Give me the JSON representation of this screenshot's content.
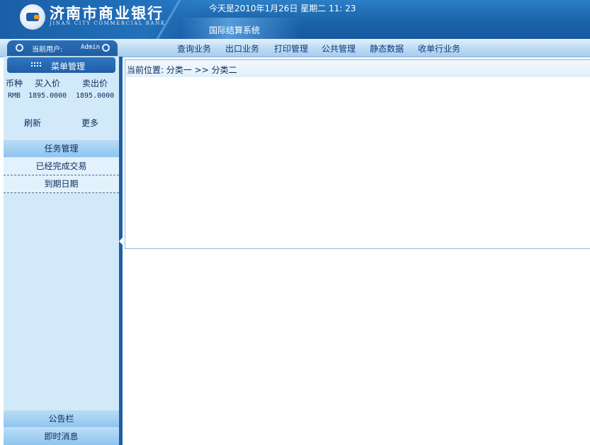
{
  "header": {
    "bank_name": "济南市商业银行",
    "bank_name_en": "JINAN CITY COMMERCIAL BANK",
    "date_text": "今天是2010年1月26日 星期二 11: 23",
    "system_name": "国际结算系统"
  },
  "user": {
    "current_label": "当前用户:",
    "username": "Admin"
  },
  "nav": {
    "items": [
      "查询业务",
      "出口业务",
      "打印管理",
      "公共管理",
      "静态数据",
      "收单行业务"
    ]
  },
  "sidebar": {
    "menu_title": "菜单管理",
    "rates": {
      "headers": [
        "币种",
        "买入价",
        "卖出价"
      ],
      "rows": [
        [
          "RMB",
          "1895.0000",
          "1895.0000"
        ]
      ]
    },
    "refresh_label": "刷新",
    "more_label": "更多",
    "task_section": "任务管理",
    "task_items": [
      "已经完成交易",
      "到期日期"
    ],
    "notice_section": "公告栏",
    "message_section": "即时消息"
  },
  "main": {
    "breadcrumb": "当前位置: 分类一 >> 分类二"
  },
  "colors": {
    "header_blue": "#1b63aa",
    "nav_light": "#bcdaf3",
    "sidebar_bg": "#d2e9fa",
    "text_dark": "#0b2c5a"
  }
}
